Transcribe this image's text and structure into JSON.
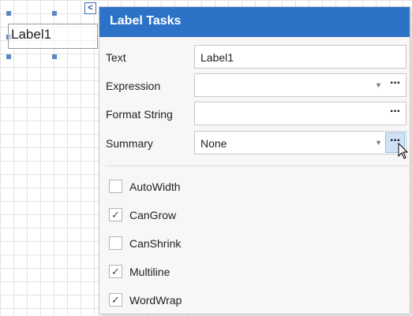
{
  "designer": {
    "label_text": "Label1",
    "smart_tag_glyph": "<"
  },
  "panel": {
    "title": "Label Tasks",
    "properties": [
      {
        "label": "Text",
        "value": "Label1",
        "dropdown": false,
        "ellipsis": false
      },
      {
        "label": "Expression",
        "value": "",
        "dropdown": true,
        "ellipsis": true
      },
      {
        "label": "Format String",
        "value": "",
        "dropdown": false,
        "ellipsis": true
      },
      {
        "label": "Summary",
        "value": "None",
        "dropdown": true,
        "ellipsis": true
      }
    ],
    "ellipsis_glyph": "···",
    "dropdown_glyph": "▼",
    "checkboxes": [
      {
        "label": "AutoWidth",
        "checked": false
      },
      {
        "label": "CanGrow",
        "checked": true
      },
      {
        "label": "CanShrink",
        "checked": false
      },
      {
        "label": "Multiline",
        "checked": true
      },
      {
        "label": "WordWrap",
        "checked": true
      }
    ],
    "check_glyph": "✓"
  },
  "colors": {
    "header": "#2c73c8",
    "grid": "#e3e3e3",
    "hover": "#cfe1f5"
  },
  "icons": {
    "smart_tag": "chevron-left-icon",
    "cursor": "mouse-pointer-icon"
  }
}
